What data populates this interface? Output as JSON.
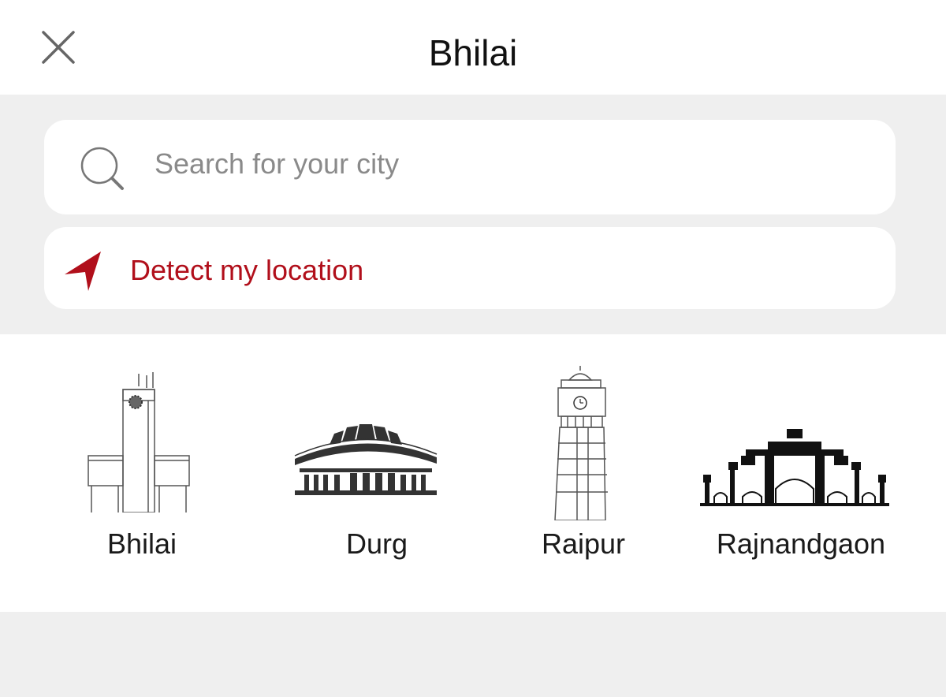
{
  "header": {
    "title": "Bhilai",
    "close_icon": "close-icon"
  },
  "search": {
    "placeholder": "Search for your city",
    "value": "",
    "icon": "search-icon"
  },
  "detect": {
    "label": "Detect my location",
    "icon": "navigation-arrow-icon",
    "color": "#b10f1b"
  },
  "cities": [
    {
      "name": "Bhilai",
      "icon": "bhilai-landmark-icon"
    },
    {
      "name": "Durg",
      "icon": "durg-landmark-icon"
    },
    {
      "name": "Raipur",
      "icon": "raipur-clock-tower-icon"
    },
    {
      "name": "Rajnandgaon",
      "icon": "rajnandgaon-palace-icon"
    }
  ],
  "colors": {
    "background": "#efefef",
    "surface": "#ffffff",
    "accent": "#b10f1b"
  }
}
